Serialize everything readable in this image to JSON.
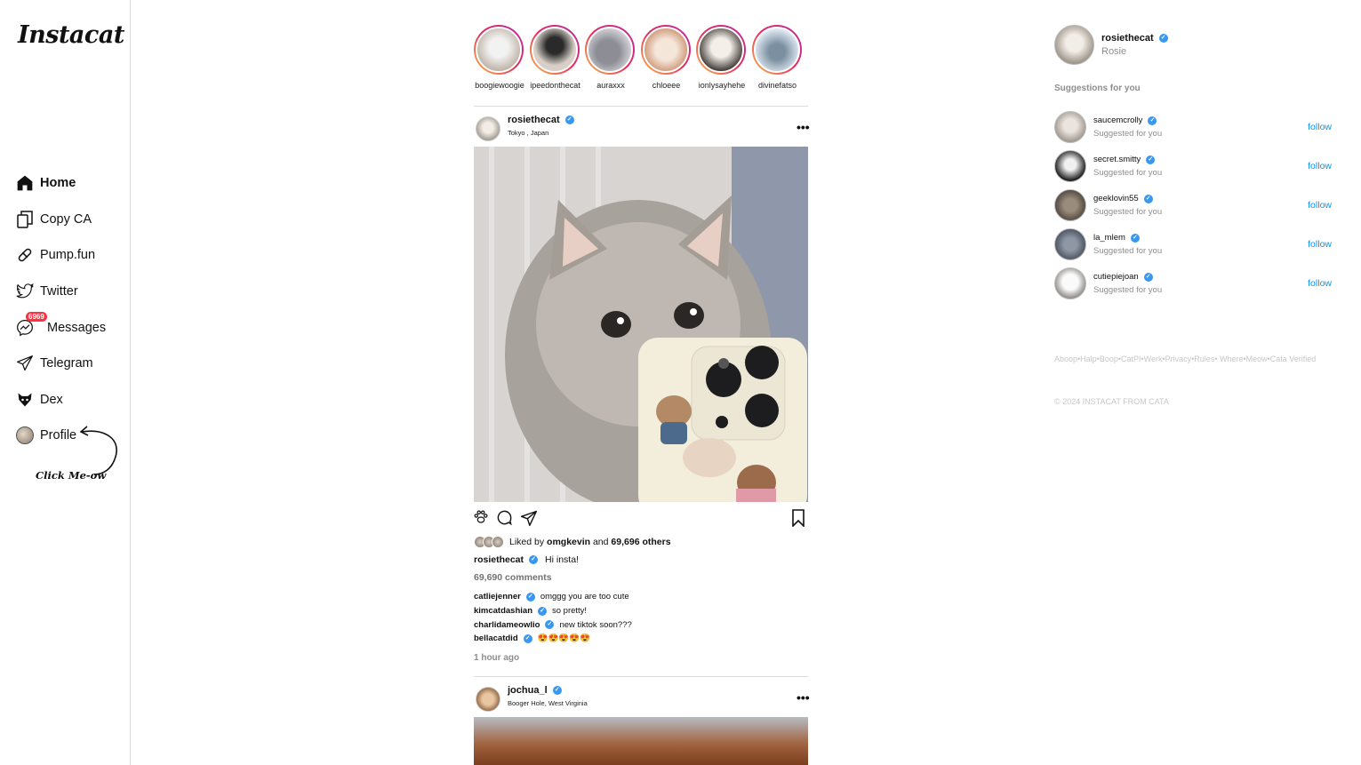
{
  "app": {
    "logo": "Instacat"
  },
  "nav": [
    {
      "label": "Home",
      "icon": "home-icon"
    },
    {
      "label": "Copy CA",
      "icon": "copy-icon"
    },
    {
      "label": "Pump.fun",
      "icon": "pill-icon"
    },
    {
      "label": "Twitter",
      "icon": "twitter-icon"
    },
    {
      "label": "Messages",
      "icon": "messenger-icon",
      "badge": "6969"
    },
    {
      "label": "Telegram",
      "icon": "telegram-icon"
    },
    {
      "label": "Dex",
      "icon": "dex-icon"
    },
    {
      "label": "Profile",
      "icon": "profile-avatar"
    }
  ],
  "click_hint": "Click Me-ow",
  "stories": [
    {
      "name": "boogiewoogie"
    },
    {
      "name": "ipeedonthecat"
    },
    {
      "name": "auraxxx"
    },
    {
      "name": "chloeee"
    },
    {
      "name": "ionlysayhehe"
    },
    {
      "name": "divinefatso"
    }
  ],
  "posts": [
    {
      "user": "rosiethecat",
      "location": "Tokyo , Japan",
      "liked_by_prefix": "Liked by",
      "liked_by_user": "omgkevin",
      "liked_by_and": "and",
      "liked_by_others": "69,696 others",
      "caption": "Hi insta!",
      "comments_count": "69,690 comments",
      "comments": [
        {
          "user": "catliejenner",
          "text": "omggg you are too cute"
        },
        {
          "user": "kimcatdashian",
          "text": "so pretty!"
        },
        {
          "user": "charlidameowlio",
          "text": "new tiktok soon???"
        },
        {
          "user": "bellacatdid",
          "text": "😍😍😍😍😍"
        }
      ],
      "time": "1 hour ago"
    },
    {
      "user": "jochua_l",
      "location": "Booger Hole, West Virginia"
    }
  ],
  "me": {
    "username": "rosiethecat",
    "name": "Rosie"
  },
  "suggestions_title": "Suggestions for you",
  "suggestions": [
    {
      "name": "saucemcrolly",
      "sub": "Suggested for you",
      "action": "follow"
    },
    {
      "name": "secret.smitty",
      "sub": "Suggested for you",
      "action": "follow"
    },
    {
      "name": "geeklovin55",
      "sub": "Suggested for you",
      "action": "follow"
    },
    {
      "name": "la_mlem",
      "sub": "Suggested for you",
      "action": "follow"
    },
    {
      "name": "cutiepiejoan",
      "sub": "Suggested for you",
      "action": "follow"
    }
  ],
  "footer_links": "Aboop•Halp•Boop•CatPI•Werk•Privacy•Rules• Where•Meow•Cata Verified",
  "copyright": "© 2024 INSTACAT FROM CATA",
  "colors": {
    "accent": "#0095f6",
    "verified": "#3897f0",
    "badge": "#ff3040",
    "story_ring": [
      "#f9c24c",
      "#e8295b",
      "#b62fa8"
    ]
  }
}
